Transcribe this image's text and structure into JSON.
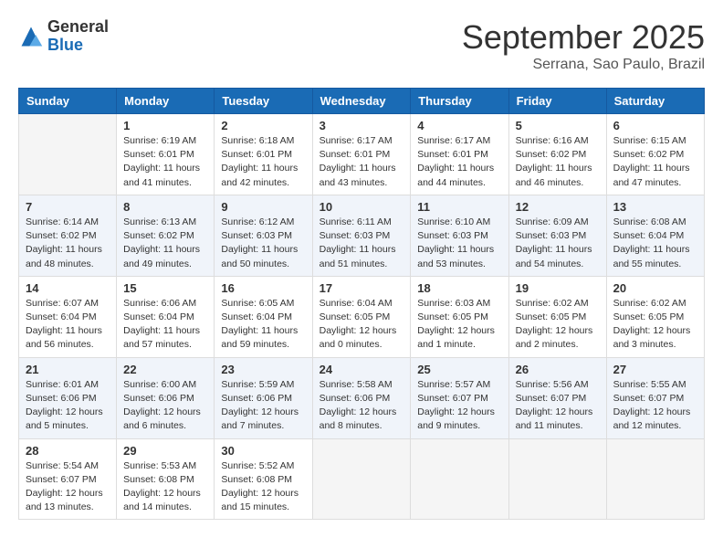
{
  "header": {
    "logo": {
      "line1": "General",
      "line2": "Blue"
    },
    "title": "September 2025",
    "subtitle": "Serrana, Sao Paulo, Brazil"
  },
  "weekdays": [
    "Sunday",
    "Monday",
    "Tuesday",
    "Wednesday",
    "Thursday",
    "Friday",
    "Saturday"
  ],
  "weeks": [
    [
      {
        "day": "",
        "info": ""
      },
      {
        "day": "1",
        "info": "Sunrise: 6:19 AM\nSunset: 6:01 PM\nDaylight: 11 hours\nand 41 minutes."
      },
      {
        "day": "2",
        "info": "Sunrise: 6:18 AM\nSunset: 6:01 PM\nDaylight: 11 hours\nand 42 minutes."
      },
      {
        "day": "3",
        "info": "Sunrise: 6:17 AM\nSunset: 6:01 PM\nDaylight: 11 hours\nand 43 minutes."
      },
      {
        "day": "4",
        "info": "Sunrise: 6:17 AM\nSunset: 6:01 PM\nDaylight: 11 hours\nand 44 minutes."
      },
      {
        "day": "5",
        "info": "Sunrise: 6:16 AM\nSunset: 6:02 PM\nDaylight: 11 hours\nand 46 minutes."
      },
      {
        "day": "6",
        "info": "Sunrise: 6:15 AM\nSunset: 6:02 PM\nDaylight: 11 hours\nand 47 minutes."
      }
    ],
    [
      {
        "day": "7",
        "info": "Sunrise: 6:14 AM\nSunset: 6:02 PM\nDaylight: 11 hours\nand 48 minutes."
      },
      {
        "day": "8",
        "info": "Sunrise: 6:13 AM\nSunset: 6:02 PM\nDaylight: 11 hours\nand 49 minutes."
      },
      {
        "day": "9",
        "info": "Sunrise: 6:12 AM\nSunset: 6:03 PM\nDaylight: 11 hours\nand 50 minutes."
      },
      {
        "day": "10",
        "info": "Sunrise: 6:11 AM\nSunset: 6:03 PM\nDaylight: 11 hours\nand 51 minutes."
      },
      {
        "day": "11",
        "info": "Sunrise: 6:10 AM\nSunset: 6:03 PM\nDaylight: 11 hours\nand 53 minutes."
      },
      {
        "day": "12",
        "info": "Sunrise: 6:09 AM\nSunset: 6:03 PM\nDaylight: 11 hours\nand 54 minutes."
      },
      {
        "day": "13",
        "info": "Sunrise: 6:08 AM\nSunset: 6:04 PM\nDaylight: 11 hours\nand 55 minutes."
      }
    ],
    [
      {
        "day": "14",
        "info": "Sunrise: 6:07 AM\nSunset: 6:04 PM\nDaylight: 11 hours\nand 56 minutes."
      },
      {
        "day": "15",
        "info": "Sunrise: 6:06 AM\nSunset: 6:04 PM\nDaylight: 11 hours\nand 57 minutes."
      },
      {
        "day": "16",
        "info": "Sunrise: 6:05 AM\nSunset: 6:04 PM\nDaylight: 11 hours\nand 59 minutes."
      },
      {
        "day": "17",
        "info": "Sunrise: 6:04 AM\nSunset: 6:05 PM\nDaylight: 12 hours\nand 0 minutes."
      },
      {
        "day": "18",
        "info": "Sunrise: 6:03 AM\nSunset: 6:05 PM\nDaylight: 12 hours\nand 1 minute."
      },
      {
        "day": "19",
        "info": "Sunrise: 6:02 AM\nSunset: 6:05 PM\nDaylight: 12 hours\nand 2 minutes."
      },
      {
        "day": "20",
        "info": "Sunrise: 6:02 AM\nSunset: 6:05 PM\nDaylight: 12 hours\nand 3 minutes."
      }
    ],
    [
      {
        "day": "21",
        "info": "Sunrise: 6:01 AM\nSunset: 6:06 PM\nDaylight: 12 hours\nand 5 minutes."
      },
      {
        "day": "22",
        "info": "Sunrise: 6:00 AM\nSunset: 6:06 PM\nDaylight: 12 hours\nand 6 minutes."
      },
      {
        "day": "23",
        "info": "Sunrise: 5:59 AM\nSunset: 6:06 PM\nDaylight: 12 hours\nand 7 minutes."
      },
      {
        "day": "24",
        "info": "Sunrise: 5:58 AM\nSunset: 6:06 PM\nDaylight: 12 hours\nand 8 minutes."
      },
      {
        "day": "25",
        "info": "Sunrise: 5:57 AM\nSunset: 6:07 PM\nDaylight: 12 hours\nand 9 minutes."
      },
      {
        "day": "26",
        "info": "Sunrise: 5:56 AM\nSunset: 6:07 PM\nDaylight: 12 hours\nand 11 minutes."
      },
      {
        "day": "27",
        "info": "Sunrise: 5:55 AM\nSunset: 6:07 PM\nDaylight: 12 hours\nand 12 minutes."
      }
    ],
    [
      {
        "day": "28",
        "info": "Sunrise: 5:54 AM\nSunset: 6:07 PM\nDaylight: 12 hours\nand 13 minutes."
      },
      {
        "day": "29",
        "info": "Sunrise: 5:53 AM\nSunset: 6:08 PM\nDaylight: 12 hours\nand 14 minutes."
      },
      {
        "day": "30",
        "info": "Sunrise: 5:52 AM\nSunset: 6:08 PM\nDaylight: 12 hours\nand 15 minutes."
      },
      {
        "day": "",
        "info": ""
      },
      {
        "day": "",
        "info": ""
      },
      {
        "day": "",
        "info": ""
      },
      {
        "day": "",
        "info": ""
      }
    ]
  ]
}
